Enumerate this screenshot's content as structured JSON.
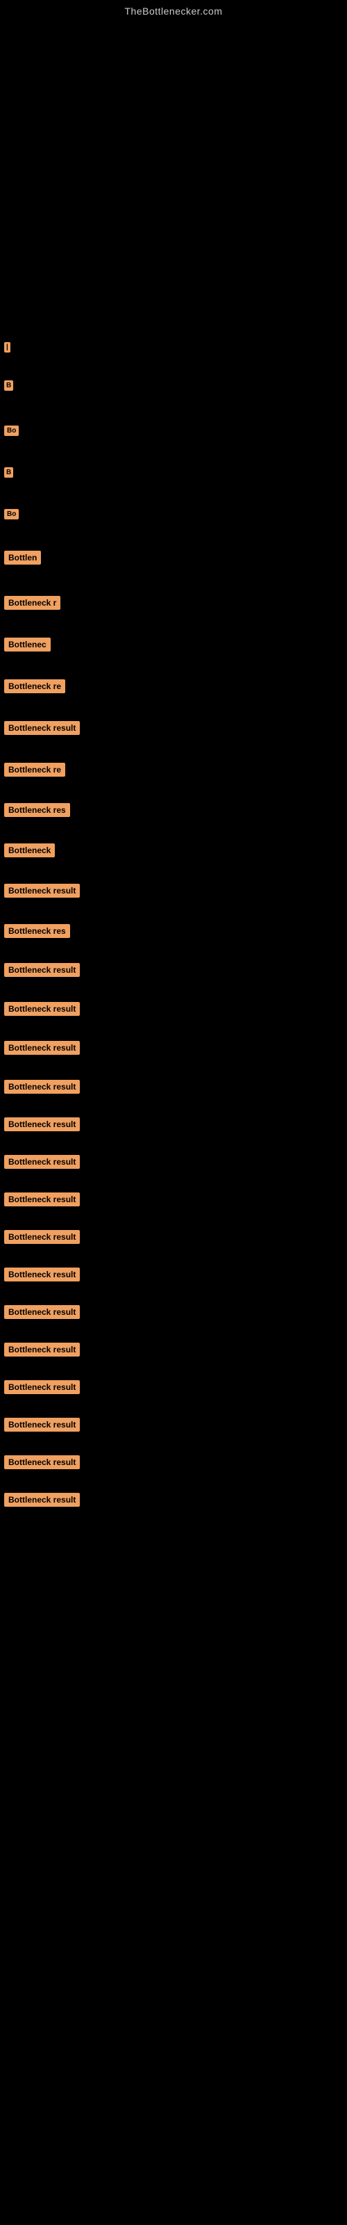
{
  "site": {
    "title": "TheBottlenecker.com"
  },
  "items": [
    {
      "id": 1,
      "label": "|",
      "width_class": "tiny"
    },
    {
      "id": 2,
      "label": "B",
      "width_class": "tiny"
    },
    {
      "id": 3,
      "label": "Bo",
      "width_class": "xsmall"
    },
    {
      "id": 4,
      "label": "B",
      "width_class": "tiny"
    },
    {
      "id": 5,
      "label": "Bo",
      "width_class": "xsmall"
    },
    {
      "id": 6,
      "label": "Bottlen",
      "width_class": "small"
    },
    {
      "id": 7,
      "label": "Bottleneck r",
      "width_class": "medium-small"
    },
    {
      "id": 8,
      "label": "Bottlenec",
      "width_class": "small-med"
    },
    {
      "id": 9,
      "label": "Bottleneck re",
      "width_class": "medium"
    },
    {
      "id": 10,
      "label": "Bottleneck result",
      "width_class": "full"
    },
    {
      "id": 11,
      "label": "Bottleneck re",
      "width_class": "medium"
    },
    {
      "id": 12,
      "label": "Bottleneck res",
      "width_class": "medium-large"
    },
    {
      "id": 13,
      "label": "Bottleneck",
      "width_class": "medium"
    },
    {
      "id": 14,
      "label": "Bottleneck result",
      "width_class": "full"
    },
    {
      "id": 15,
      "label": "Bottleneck res",
      "width_class": "medium-large"
    },
    {
      "id": 16,
      "label": "Bottleneck result",
      "width_class": "full"
    },
    {
      "id": 17,
      "label": "Bottleneck result",
      "width_class": "full"
    },
    {
      "id": 18,
      "label": "Bottleneck result",
      "width_class": "full"
    },
    {
      "id": 19,
      "label": "Bottleneck result",
      "width_class": "full"
    },
    {
      "id": 20,
      "label": "Bottleneck result",
      "width_class": "full"
    },
    {
      "id": 21,
      "label": "Bottleneck result",
      "width_class": "full"
    },
    {
      "id": 22,
      "label": "Bottleneck result",
      "width_class": "full"
    },
    {
      "id": 23,
      "label": "Bottleneck result",
      "width_class": "full"
    },
    {
      "id": 24,
      "label": "Bottleneck result",
      "width_class": "full"
    },
    {
      "id": 25,
      "label": "Bottleneck result",
      "width_class": "full"
    },
    {
      "id": 26,
      "label": "Bottleneck result",
      "width_class": "full"
    },
    {
      "id": 27,
      "label": "Bottleneck result",
      "width_class": "full"
    },
    {
      "id": 28,
      "label": "Bottleneck result",
      "width_class": "full"
    },
    {
      "id": 29,
      "label": "Bottleneck result",
      "width_class": "full"
    },
    {
      "id": 30,
      "label": "Bottleneck result",
      "width_class": "full"
    }
  ]
}
